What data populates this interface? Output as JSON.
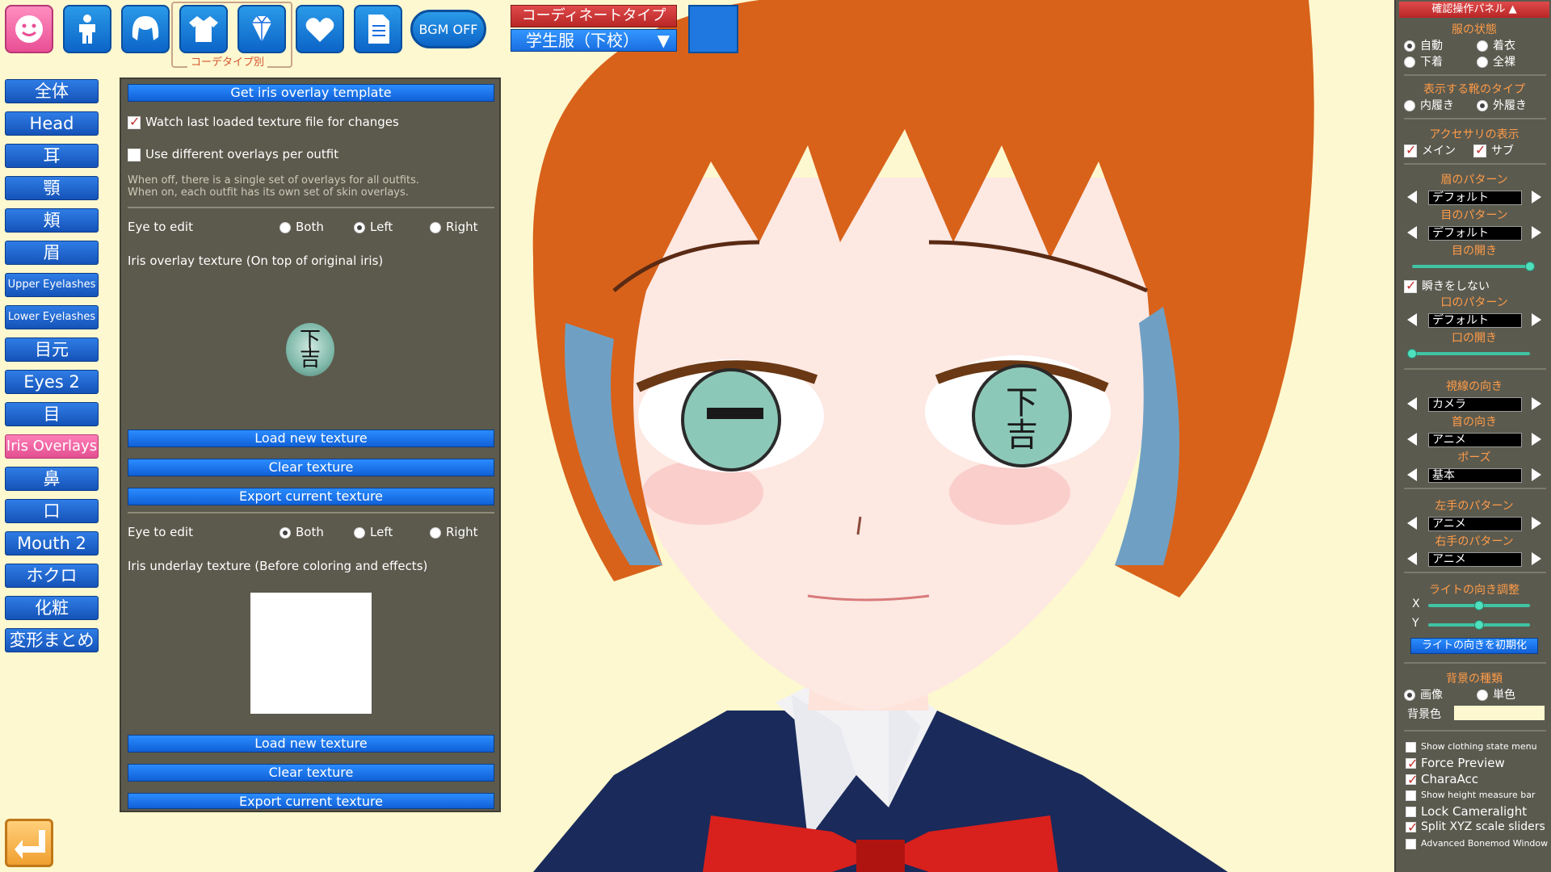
{
  "toolbar": {
    "buttons": [
      {
        "name": "face-icon"
      },
      {
        "name": "body-icon"
      },
      {
        "name": "hair-icon"
      },
      {
        "name": "clothing-icon"
      },
      {
        "name": "accessory-icon"
      },
      {
        "name": "heart-icon"
      },
      {
        "name": "document-icon"
      }
    ],
    "bgm_label": "BGM OFF",
    "coordinate_caption": "コーデタイプ別",
    "coordinate_type_label": "コーディネートタイプ",
    "coordinate_type_value": "学生服（下校）",
    "coordinate_arrow": "▼",
    "swatch_color": "#1e78e0"
  },
  "categories": [
    {
      "label": "全体"
    },
    {
      "label": "Head"
    },
    {
      "label": "耳"
    },
    {
      "label": "顎"
    },
    {
      "label": "頬"
    },
    {
      "label": "眉"
    },
    {
      "label": "Upper Eyelashes"
    },
    {
      "label": "Lower Eyelashes"
    },
    {
      "label": "目元"
    },
    {
      "label": "Eyes 2"
    },
    {
      "label": "目"
    },
    {
      "label": "Iris Overlays"
    },
    {
      "label": "鼻"
    },
    {
      "label": "口"
    },
    {
      "label": "Mouth 2"
    },
    {
      "label": "ホクロ"
    },
    {
      "label": "化粧"
    },
    {
      "label": "変形まとめ"
    }
  ],
  "panel": {
    "get_template": "Get iris overlay template",
    "watch_file": "Watch last loaded texture file for changes",
    "per_outfit": "Use different overlays per outfit",
    "note_line1": "When off, there is a single set of overlays for all outfits.",
    "note_line2": "When on, each outfit has its own set of skin overlays.",
    "eye_to_edit": "Eye to edit",
    "opt_both": "Both",
    "opt_left": "Left",
    "opt_right": "Right",
    "overlay_title": "Iris overlay texture (On top of original iris)",
    "overlay_glyph": "下吉",
    "load_texture": "Load new texture",
    "clear_texture": "Clear texture",
    "export_texture": "Export current texture",
    "underlay_title": "Iris underlay texture (Before coloring and effects)"
  },
  "right_panel": {
    "header": "確認操作パネル",
    "header_arrow": "▲",
    "clothes_state": "服の状態",
    "auto": "自動",
    "dressed": "着衣",
    "underwear": "下着",
    "naked": "全裸",
    "shoe_type": "表示する靴のタイプ",
    "indoor": "内履き",
    "outdoor": "外履き",
    "accessory_display": "アクセサリの表示",
    "main": "メイン",
    "sub": "サブ",
    "brow_pattern": "眉のパターン",
    "default": "デフォルト",
    "eye_pattern": "目のパターン",
    "eye_open": "目の開き",
    "no_blink": "瞬きをしない",
    "mouth_pattern": "口のパターン",
    "mouth_open": "口の開き",
    "gaze_dir": "視線の向き",
    "camera": "カメラ",
    "neck_dir": "首の向き",
    "anime": "アニメ",
    "pose": "ポーズ",
    "basic": "基本",
    "left_hand": "左手のパターン",
    "right_hand": "右手のパターン",
    "light_adjust": "ライトの向き調整",
    "x": "X",
    "y": "Y",
    "light_reset": "ライトの向きを初期化",
    "bg_type": "背景の種類",
    "image": "画像",
    "solid": "単色",
    "bg_color": "背景色",
    "show_clothing_menu": "Show clothing state menu",
    "force_preview": "Force Preview",
    "chara_acc": "CharaAcc",
    "height_bar": "Show height measure bar",
    "lock_cameralight": "Lock Cameralight",
    "split_xyz": "Split XYZ scale sliders",
    "adv_bonemod": "Advanced Bonemod Window",
    "eye_open_level": 1.0,
    "mouth_open_level": 0.0,
    "light_x": 0.5,
    "light_y": 0.5
  }
}
